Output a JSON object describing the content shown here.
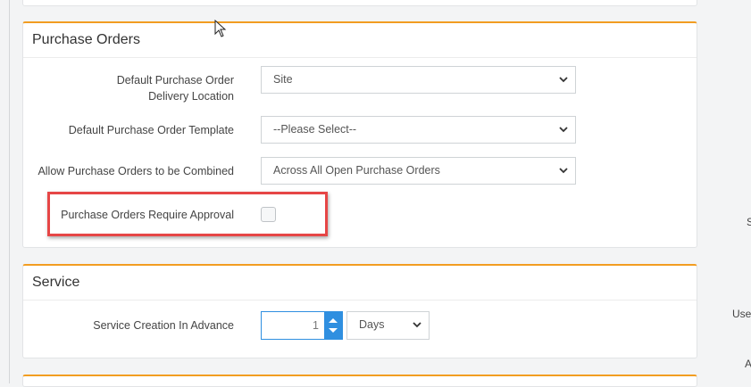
{
  "purchase_orders": {
    "title": "Purchase Orders",
    "fields": [
      {
        "label": "Default Purchase Order Delivery Location",
        "value": "Site"
      },
      {
        "label": "Default Purchase Order Template",
        "value": "--Please Select--"
      },
      {
        "label": "Allow Purchase Orders to be Combined",
        "value": "Across All Open Purchase Orders"
      }
    ],
    "approval_label": "Purchase Orders Require Approval",
    "approval_checked": false
  },
  "service": {
    "title": "Service",
    "creation_label": "Service Creation In Advance",
    "creation_value": "1",
    "unit_value": "Days"
  },
  "right_edge_fragments": [
    "S",
    "Use",
    "A"
  ],
  "colors": {
    "accent": "#f29d21",
    "highlight": "#e64646",
    "focus": "#2f8fe0"
  }
}
